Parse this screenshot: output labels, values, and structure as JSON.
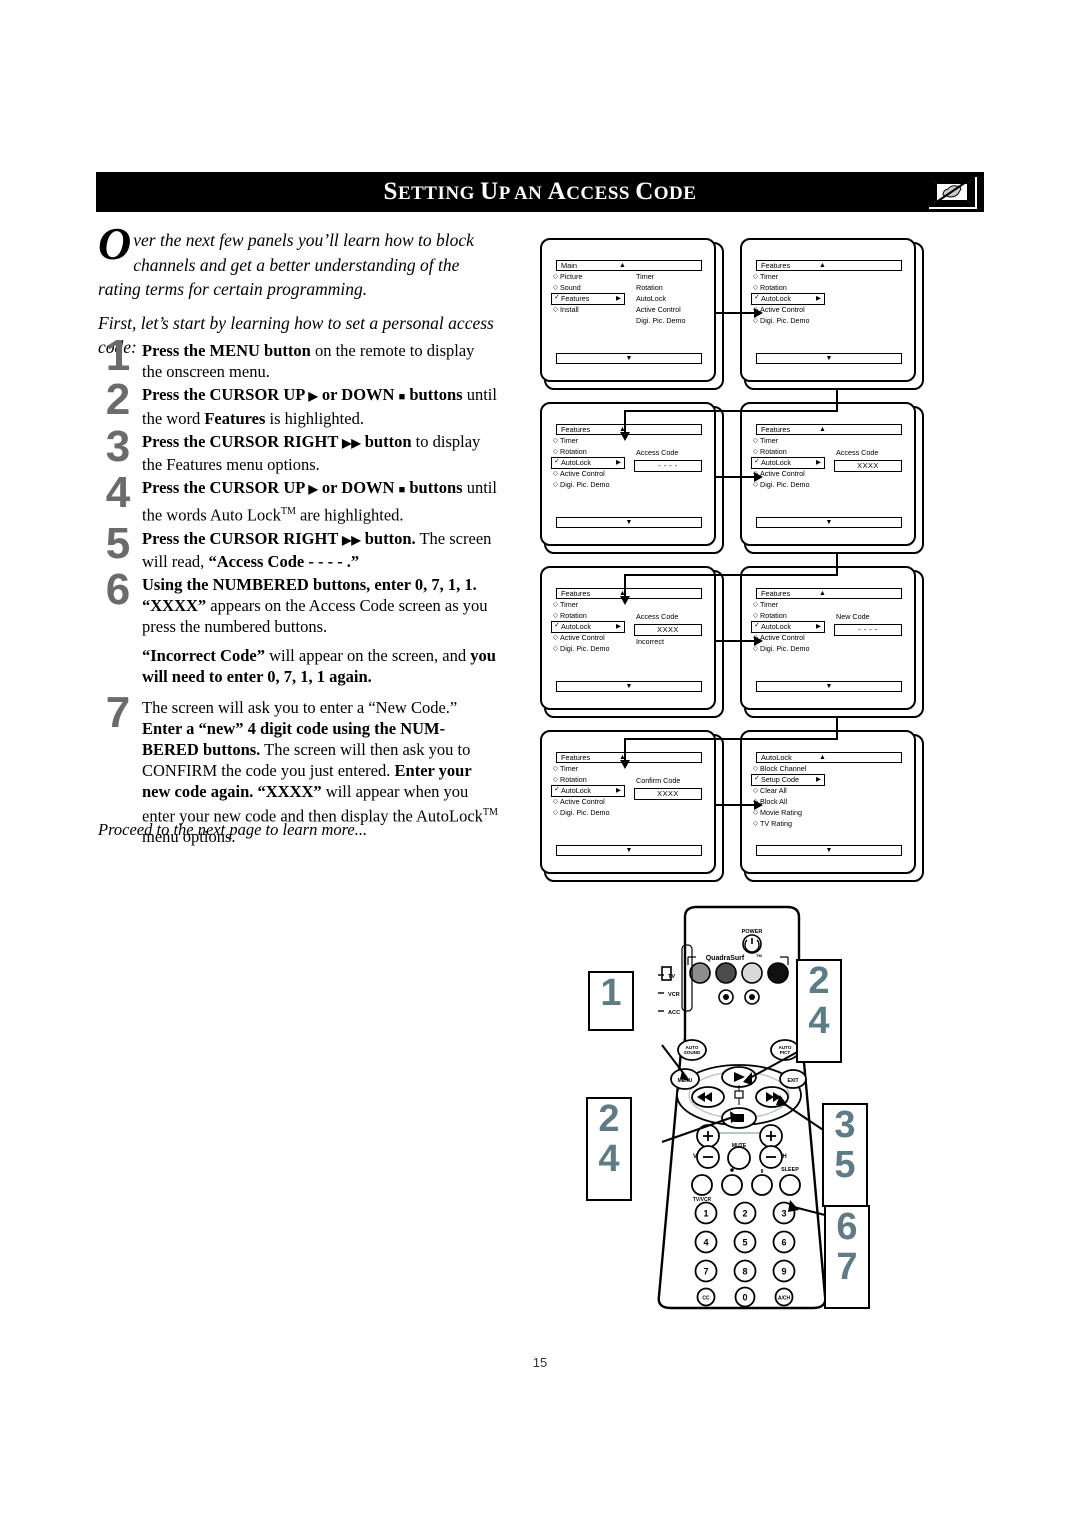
{
  "header": {
    "title_parts": [
      {
        "text": "S",
        "cap": true
      },
      {
        "text": "ETTING ",
        "cap": false
      },
      {
        "text": "U",
        "cap": true
      },
      {
        "text": "P AN ",
        "cap": false
      },
      {
        "text": "A",
        "cap": true
      },
      {
        "text": "CCESS ",
        "cap": false
      },
      {
        "text": "C",
        "cap": true
      },
      {
        "text": "ODE",
        "cap": false
      }
    ],
    "title_plain": "SETTING UP AN ACCESS CODE",
    "icon_name": "tv-hand-blocked-icon"
  },
  "intro": {
    "dropcap": "O",
    "para1": "ver the next few panels you’ll learn how to block channels and get a better understanding of the rating terms for certain programming.",
    "para2": "First, let’s start by learning how to set a personal access code:"
  },
  "steps": [
    {
      "num": "1",
      "html": "<b>Press the MENU button</b> on the remote to display the onscreen menu."
    },
    {
      "num": "2",
      "html": "<b>Press the CURSOR UP <span class=\"tri\">▶</span> or DOWN <span class=\"sq\">■</span> buttons</b> until the word <b>Features</b> is highlighted."
    },
    {
      "num": "3",
      "html": "<b>Press the CURSOR RIGHT <span class=\"tri\">▶▶</span> button</b> to display the Features menu options."
    },
    {
      "num": "4",
      "html": "<b>Press the CURSOR UP <span class=\"tri\">▶</span> or DOWN <span class=\"sq\">■</span> buttons</b> until the words Auto Lock<span class=\"tm\">TM</span> are highlighted."
    },
    {
      "num": "5",
      "html": "<b>Press the CURSOR RIGHT <span class=\"tri\">▶▶</span> button.</b> The screen will read, <b>“Access Code - - - - .”</b>"
    },
    {
      "num": "6",
      "html": "<b>Using the NUMBERED buttons, enter 0, 7, 1, 1. “XXXX”</b> appears on the Access Code screen as you press the numbered buttons."
    }
  ],
  "note_html": "<b>“Incorrect Code”</b> will appear on the screen, and <b>you will need to enter 0, 7, 1, 1 again.</b>",
  "step7": {
    "num": "7",
    "html": "The screen will ask you to enter a “New Code.” <b>Enter a “new” 4 digit code using the NUM-BERED buttons.</b> The screen will then ask you to CONFIRM the code you just entered. <b>Enter your new code again. “XXXX”</b> will appear when you enter your new code and then display the AutoLock<span class=\"tm\">TM</span> menu options."
  },
  "outro": "Proceed to the next page to learn more...",
  "screens": [
    {
      "id": "screen-1-main-menu",
      "title": "Main",
      "up_arrow": "▲",
      "down_arrow": "▼",
      "left_items": [
        "Picture",
        "Sound",
        "Features",
        "Install"
      ],
      "selected_index": 2,
      "right_items": [
        "Timer",
        "Rotation",
        "AutoLock",
        "Active Control",
        "Digi. Pic. Demo"
      ],
      "value_label": "",
      "value_text": "",
      "extra_text": ""
    },
    {
      "id": "screen-2-features-menu",
      "title": "Features",
      "up_arrow": "▲",
      "down_arrow": "▼",
      "left_items": [
        "Timer",
        "Rotation",
        "AutoLock",
        "Active Control",
        "Digi. Pic. Demo"
      ],
      "selected_index": 2,
      "right_items": [],
      "value_label": "",
      "value_text": "",
      "extra_text": ""
    },
    {
      "id": "screen-3-access-code-empty",
      "title": "Features",
      "up_arrow": "▲",
      "down_arrow": "▼",
      "left_items": [
        "Timer",
        "Rotation",
        "AutoLock",
        "Active Control",
        "Digi. Pic. Demo"
      ],
      "selected_index": 2,
      "right_items": [],
      "value_label": "Access Code",
      "value_text": "- - - -",
      "extra_text": ""
    },
    {
      "id": "screen-4-access-code-xxxx",
      "title": "Features",
      "up_arrow": "▲",
      "down_arrow": "▼",
      "left_items": [
        "Timer",
        "Rotation",
        "AutoLock",
        "Active Control",
        "Digi. Pic. Demo"
      ],
      "selected_index": 2,
      "right_items": [],
      "value_label": "Access Code",
      "value_text": "XXXX",
      "extra_text": ""
    },
    {
      "id": "screen-5-incorrect-code",
      "title": "Features",
      "up_arrow": "▲",
      "down_arrow": "▼",
      "left_items": [
        "Timer",
        "Rotation",
        "AutoLock",
        "Active Control",
        "Digi. Pic. Demo"
      ],
      "selected_index": 2,
      "right_items": [],
      "value_label": "Access Code",
      "value_text": "XXXX",
      "extra_text": "Incorrect"
    },
    {
      "id": "screen-6-new-code",
      "title": "Features",
      "up_arrow": "▲",
      "down_arrow": "▼",
      "left_items": [
        "Timer",
        "Rotation",
        "AutoLock",
        "Active Control",
        "Digi. Pic. Demo"
      ],
      "selected_index": 2,
      "right_items": [],
      "value_label": "New Code",
      "value_text": "- - - -",
      "extra_text": ""
    },
    {
      "id": "screen-7-confirm-code",
      "title": "Features",
      "up_arrow": "▲",
      "down_arrow": "▼",
      "left_items": [
        "Timer",
        "Rotation",
        "AutoLock",
        "Active Control",
        "Digi. Pic. Demo"
      ],
      "selected_index": 2,
      "right_items": [],
      "value_label": "Confirm Code",
      "value_text": "XXXX",
      "extra_text": ""
    },
    {
      "id": "screen-8-autolock-menu",
      "title": "AutoLock",
      "up_arrow": "▲",
      "down_arrow": "▼",
      "left_items": [
        "Block Channel",
        "Setup Code",
        "Clear All",
        "Block All",
        "Movie Rating",
        "TV Rating"
      ],
      "selected_index": 1,
      "right_items": [],
      "value_label": "",
      "value_text": "",
      "extra_text": ""
    }
  ],
  "remote": {
    "power_label": "POWER",
    "brand_label": "QuadraSurf",
    "brand_tm": "TM",
    "mode_labels": [
      "TV",
      "VCR",
      "ACC"
    ],
    "auto_sound_label": "AUTO SOUND",
    "auto_pict_label": "AUTO PICT",
    "menu_label": "MENU",
    "exit_label": "EXIT",
    "vol_label": "VOL",
    "ch_label": "CH",
    "mute_label": "MUTE",
    "sleep_label": "SLEEP",
    "tvvcr_label": "TV/VCR",
    "keypad": [
      "1",
      "2",
      "3",
      "4",
      "5",
      "6",
      "7",
      "8",
      "9",
      "CC",
      "0",
      "A/CH"
    ],
    "callouts": [
      {
        "id": "callout-1",
        "lines": [
          "1"
        ]
      },
      {
        "id": "callout-2-4",
        "lines": [
          "2",
          "4"
        ]
      },
      {
        "id": "callout-2-4-left",
        "lines": [
          "2",
          "4"
        ]
      },
      {
        "id": "callout-3-5",
        "lines": [
          "3",
          "5"
        ]
      },
      {
        "id": "callout-6-7",
        "lines": [
          "6",
          "7"
        ]
      }
    ]
  },
  "page_number": "15"
}
